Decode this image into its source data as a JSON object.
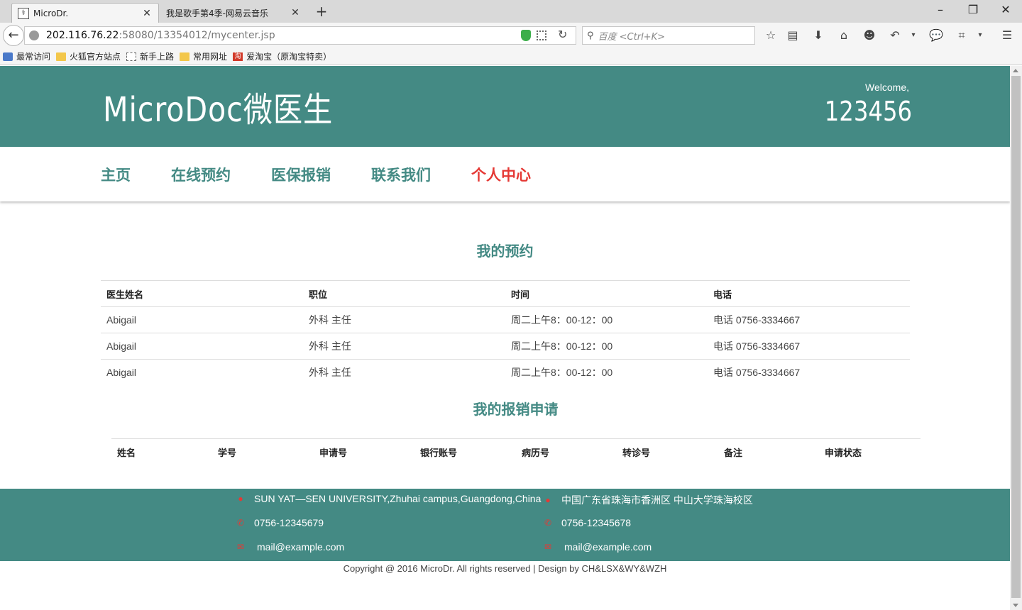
{
  "browser": {
    "tabs": [
      {
        "title": "MicroDr.",
        "active": true
      },
      {
        "title": "我是歌手第4季-网易云音乐",
        "active": false
      }
    ],
    "url_host": "202.116.76.22",
    "url_path": ":58080/13354012/mycenter.jsp",
    "search_placeholder": "百度 <Ctrl+K>",
    "bookmarks": [
      "最常访问",
      "火狐官方站点",
      "新手上路",
      "常用网址",
      "爱淘宝（原淘宝特卖）"
    ]
  },
  "header": {
    "logo": "MicroDoc微医生",
    "welcome": "Welcome,",
    "username": "123456"
  },
  "nav": [
    "主页",
    "在线预约",
    "医保报销",
    "联系我们",
    "个人中心"
  ],
  "appointments": {
    "title": "我的预约",
    "columns": [
      "医生姓名",
      "职位",
      "时间",
      "电话"
    ],
    "rows": [
      [
        "Abigail",
        "外科 主任",
        "周二上午8：00-12：00",
        "电话 0756-3334667"
      ],
      [
        "Abigail",
        "外科 主任",
        "周二上午8：00-12：00",
        "电话 0756-3334667"
      ],
      [
        "Abigail",
        "外科 主任",
        "周二上午8：00-12：00",
        "电话 0756-3334667"
      ]
    ]
  },
  "claims": {
    "title": "我的报销申请",
    "columns": [
      "姓名",
      "学号",
      "申请号",
      "银行账号",
      "病历号",
      "转诊号",
      "备注",
      "申请状态"
    ]
  },
  "footer": {
    "address_en": "SUN YAT—SEN UNIVERSITY,Zhuhai campus,Guangdong,China",
    "address_cn": "中国广东省珠海市香洲区 中山大学珠海校区",
    "phone_1": "0756-12345679",
    "phone_2": "0756-12345678",
    "email_1": "mail@example.com",
    "email_2": "mail@example.com",
    "copyright": "Copyright @ 2016 MicroDr. All rights reserved | Design by CH&LSX&WY&WZH"
  },
  "colors": {
    "brand": "#448a84",
    "accent": "#e53935"
  }
}
